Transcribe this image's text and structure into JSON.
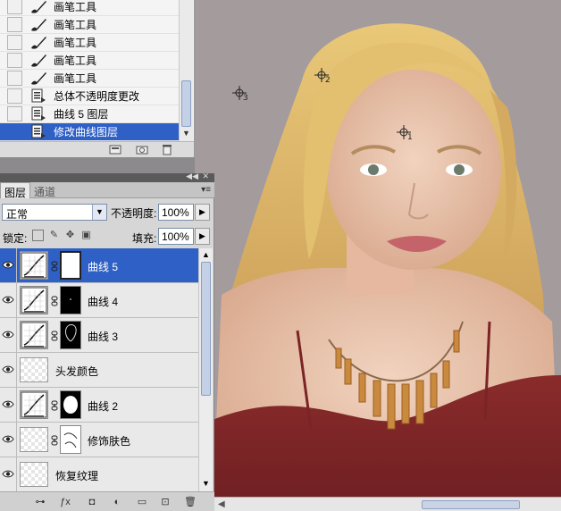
{
  "history": {
    "items": [
      {
        "label": "画笔工具",
        "icon": "brush-icon"
      },
      {
        "label": "画笔工具",
        "icon": "brush-icon"
      },
      {
        "label": "画笔工具",
        "icon": "brush-icon"
      },
      {
        "label": "画笔工具",
        "icon": "brush-icon"
      },
      {
        "label": "画笔工具",
        "icon": "brush-icon"
      },
      {
        "label": "总体不透明度更改",
        "icon": "history-state-icon"
      },
      {
        "label": "曲线 5 图层",
        "icon": "history-state-icon"
      },
      {
        "label": "修改曲线图层",
        "icon": "history-state-icon",
        "selected": true
      }
    ]
  },
  "layers_panel": {
    "tabs": [
      "图层",
      "通道"
    ],
    "blend_mode": "正常",
    "opacity_label": "不透明度:",
    "opacity_value": "100%",
    "lock_label": "锁定:",
    "fill_label": "填充:",
    "fill_value": "100%",
    "layers": [
      {
        "name": "曲线 5",
        "kind": "curves",
        "mask": "white",
        "selected": true
      },
      {
        "name": "曲线 4",
        "kind": "curves",
        "mask": "black"
      },
      {
        "name": "曲线 3",
        "kind": "curves",
        "mask": "black-outline"
      },
      {
        "name": "头发颜色",
        "kind": "raster"
      },
      {
        "name": "曲线 2",
        "kind": "curves",
        "mask": "black-blob"
      },
      {
        "name": "修饰肤色",
        "kind": "raster",
        "mask": "white-sketch"
      },
      {
        "name": "恢复纹理",
        "kind": "raster"
      }
    ],
    "footer_icons": [
      "link-layers-icon",
      "fx-icon",
      "add-mask-icon",
      "adjustment-layer-icon",
      "new-group-icon",
      "new-layer-icon",
      "trash-icon"
    ]
  },
  "canvas": {
    "color_samplers": [
      "1",
      "2",
      "3"
    ]
  },
  "colors": {
    "selection": "#2f60c6",
    "canvas_bg": "#a29a9c",
    "panel_bg": "#d6d6d6"
  }
}
